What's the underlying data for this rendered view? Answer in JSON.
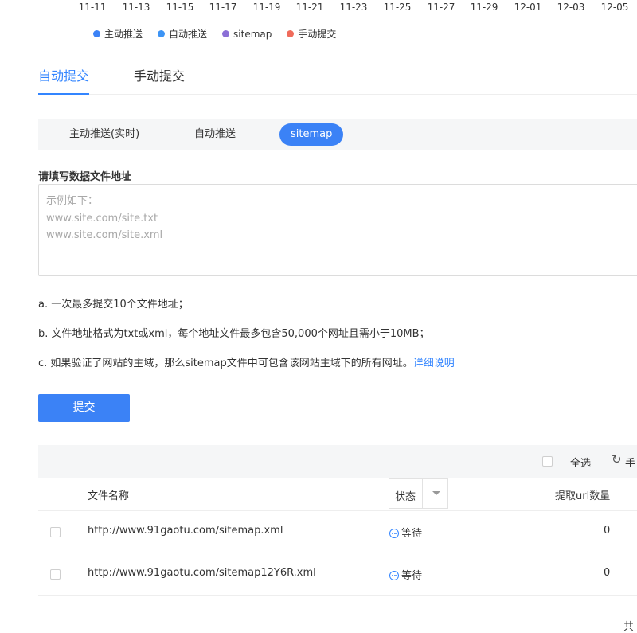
{
  "chart": {
    "x_dates": [
      "11-11",
      "11-13",
      "11-15",
      "11-17",
      "11-19",
      "11-21",
      "11-23",
      "11-25",
      "11-27",
      "11-29",
      "12-01",
      "12-03",
      "12-05"
    ],
    "legend": [
      {
        "label": "主动推送",
        "color": "#3b82f6"
      },
      {
        "label": "自动推送",
        "color": "#3d94f5"
      },
      {
        "label": "sitemap",
        "color": "#8b6fd6"
      },
      {
        "label": "手动提交",
        "color": "#f06b5b"
      }
    ]
  },
  "main_tabs": [
    {
      "label": "自动提交",
      "active": true
    },
    {
      "label": "手动提交",
      "active": false
    }
  ],
  "sub_tabs": [
    {
      "label": "主动推送(实时)",
      "active": false
    },
    {
      "label": "自动推送",
      "active": false
    },
    {
      "label": "sitemap",
      "active": true
    }
  ],
  "form": {
    "label": "请填写数据文件地址",
    "placeholder_lines": "示例如下：\nwww.site.com/site.txt\nwww.site.com/site.xml"
  },
  "notes": {
    "a": "a. 一次最多提交10个文件地址；",
    "b": "b. 文件地址格式为txt或xml，每个地址文件最多包含50,000个网址且需小于10MB；",
    "c": "c. 如果验证了网站的主域，那么sitemap文件中可包含该网站主域下的所有网址。",
    "c_link": "详细说明"
  },
  "submit_label": "提交",
  "table": {
    "toolbar": {
      "select_all": "全选",
      "refresh_label": "手"
    },
    "headers": {
      "filename": "文件名称",
      "status": "状态",
      "url_count": "提取url数量"
    },
    "rows": [
      {
        "url": "http://www.91gaotu.com/sitemap.xml",
        "status": "等待",
        "count": "0"
      },
      {
        "url": "http://www.91gaotu.com/sitemap12Y6R.xml",
        "status": "等待",
        "count": "0"
      }
    ],
    "footer_text": "共"
  }
}
